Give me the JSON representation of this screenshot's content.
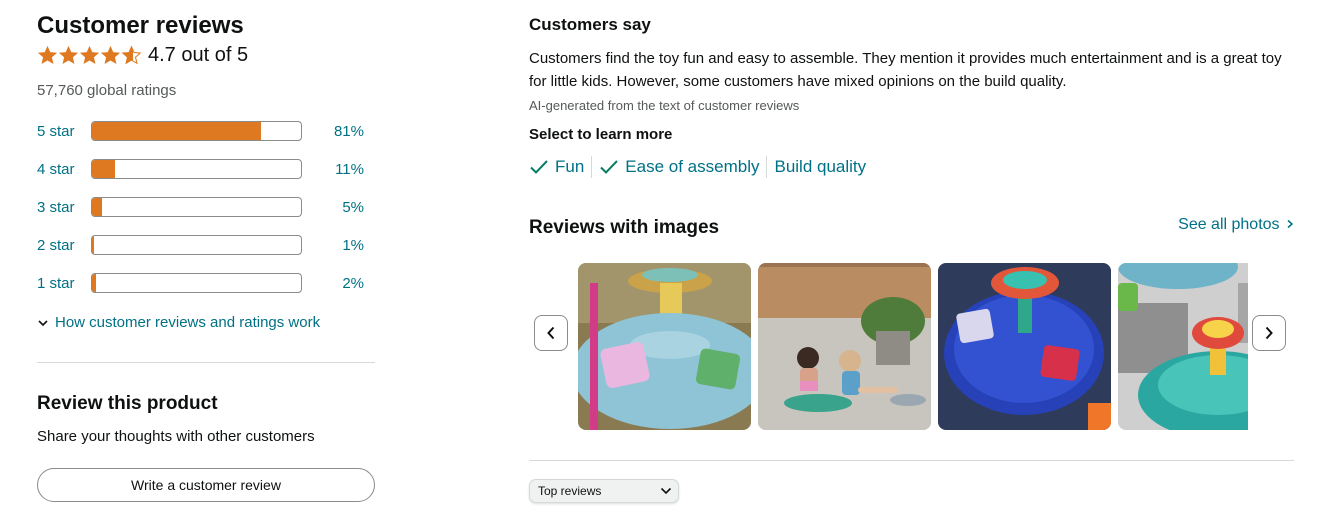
{
  "colors": {
    "star": "#DE7921",
    "link": "#007185",
    "text": "#0F1111",
    "muted": "#565959"
  },
  "reviews": {
    "title": "Customer reviews",
    "rating": 4.7,
    "rating_text": "4.7 out of 5",
    "global_ratings": "57,760 global ratings",
    "histogram": [
      {
        "label": "5 star",
        "percent_text": "81%",
        "percent": 81
      },
      {
        "label": "4 star",
        "percent_text": "11%",
        "percent": 11
      },
      {
        "label": "3 star",
        "percent_text": "5%",
        "percent": 5
      },
      {
        "label": "2 star",
        "percent_text": "1%",
        "percent": 1
      },
      {
        "label": "1 star",
        "percent_text": "2%",
        "percent": 2
      }
    ],
    "how_link": "How customer reviews and ratings work"
  },
  "review_product": {
    "heading": "Review this product",
    "subtext": "Share your thoughts with other customers",
    "button": "Write a customer review"
  },
  "customers_say": {
    "heading": "Customers say",
    "summary": "Customers find the toy fun and easy to assemble. They mention it provides much entertainment and is a great toy for little kids. However, some customers have mixed opinions on the build quality.",
    "ai_note": "AI-generated from the text of customer reviews",
    "select_heading": "Select to learn more",
    "aspects": [
      {
        "label": "Fun",
        "icon": "check-icon"
      },
      {
        "label": "Ease of assembly",
        "icon": "check-icon"
      },
      {
        "label": "Build quality",
        "icon": ""
      }
    ]
  },
  "reviews_with_images": {
    "heading": "Reviews with images",
    "see_all": "See all photos",
    "prev_icon": "chevron-left-icon",
    "next_icon": "chevron-right-icon"
  },
  "sort": {
    "selected": "Top reviews"
  }
}
